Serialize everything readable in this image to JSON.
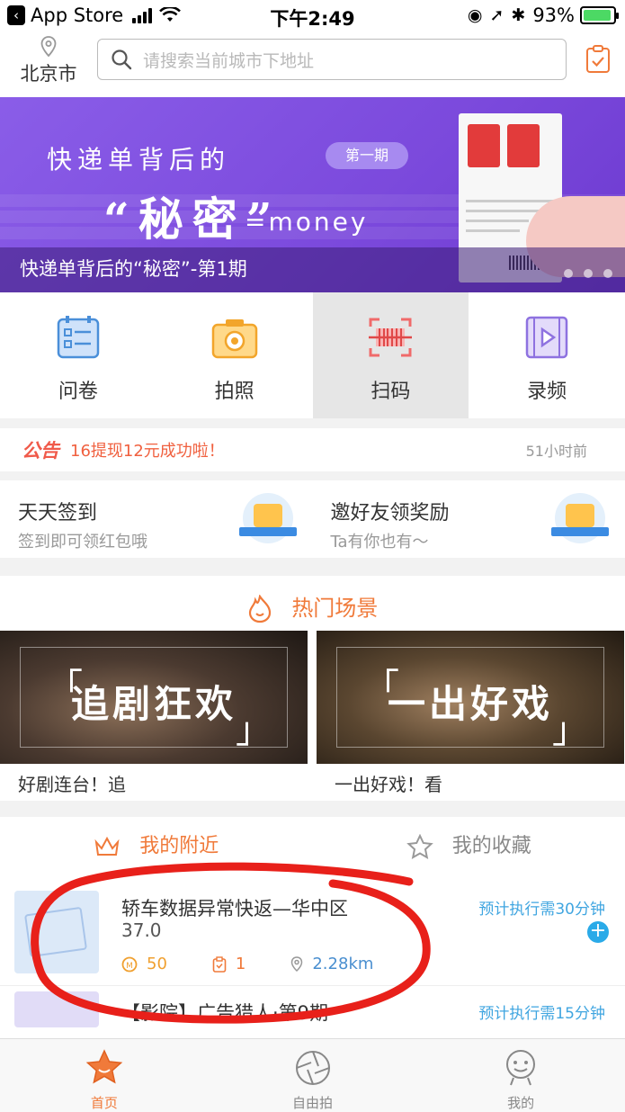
{
  "status_bar": {
    "back_label": "App Store",
    "time": "下午2:49",
    "battery": "93%"
  },
  "header": {
    "city": "北京市",
    "search_placeholder": "请搜索当前城市下地址"
  },
  "banner": {
    "title": "快递单背后的",
    "issue_badge": "第一期",
    "secret_text": "“秘密”",
    "money_text": "=money",
    "caption": "快递单背后的“秘密”-第1期"
  },
  "quick_actions": [
    {
      "label": "问卷",
      "icon": "questionnaire-icon"
    },
    {
      "label": "拍照",
      "icon": "camera-icon"
    },
    {
      "label": "扫码",
      "icon": "scan-icon"
    },
    {
      "label": "录频",
      "icon": "video-icon"
    }
  ],
  "notice": {
    "tag": "公告",
    "text": "16提现12元成功啦！",
    "time": "51小时前"
  },
  "promos": [
    {
      "title": "天天签到",
      "subtitle": "签到即可领红包哦"
    },
    {
      "title": "邀好友领奖励",
      "subtitle": "Ta有你也有～"
    }
  ],
  "hot_section": {
    "title": "热门场景",
    "scenes": [
      {
        "image_text": "追剧狂欢",
        "caption": "好剧连台！追"
      },
      {
        "image_text": "一出好戏",
        "caption": "一出好戏！看"
      }
    ]
  },
  "nearby_tabs": [
    {
      "label": "我的附近",
      "active": true
    },
    {
      "label": "我的收藏",
      "active": false
    }
  ],
  "tasks": [
    {
      "title": "轿车数据异常快返—华中区",
      "subtitle": "37.0",
      "time": "预计执行需30分钟",
      "coins": "50",
      "count": "1",
      "distance": "2.28km"
    },
    {
      "title": "【影院】广告猎人·第9期",
      "time": "预计执行需15分钟"
    }
  ],
  "tab_bar": [
    {
      "label": "首页",
      "active": true
    },
    {
      "label": "自由拍",
      "active": false
    },
    {
      "label": "我的",
      "active": false
    }
  ],
  "colors": {
    "accent": "#f07a3a",
    "banner": "#7b49dc",
    "link": "#3fa5e0",
    "annotation": "#e8201a"
  }
}
